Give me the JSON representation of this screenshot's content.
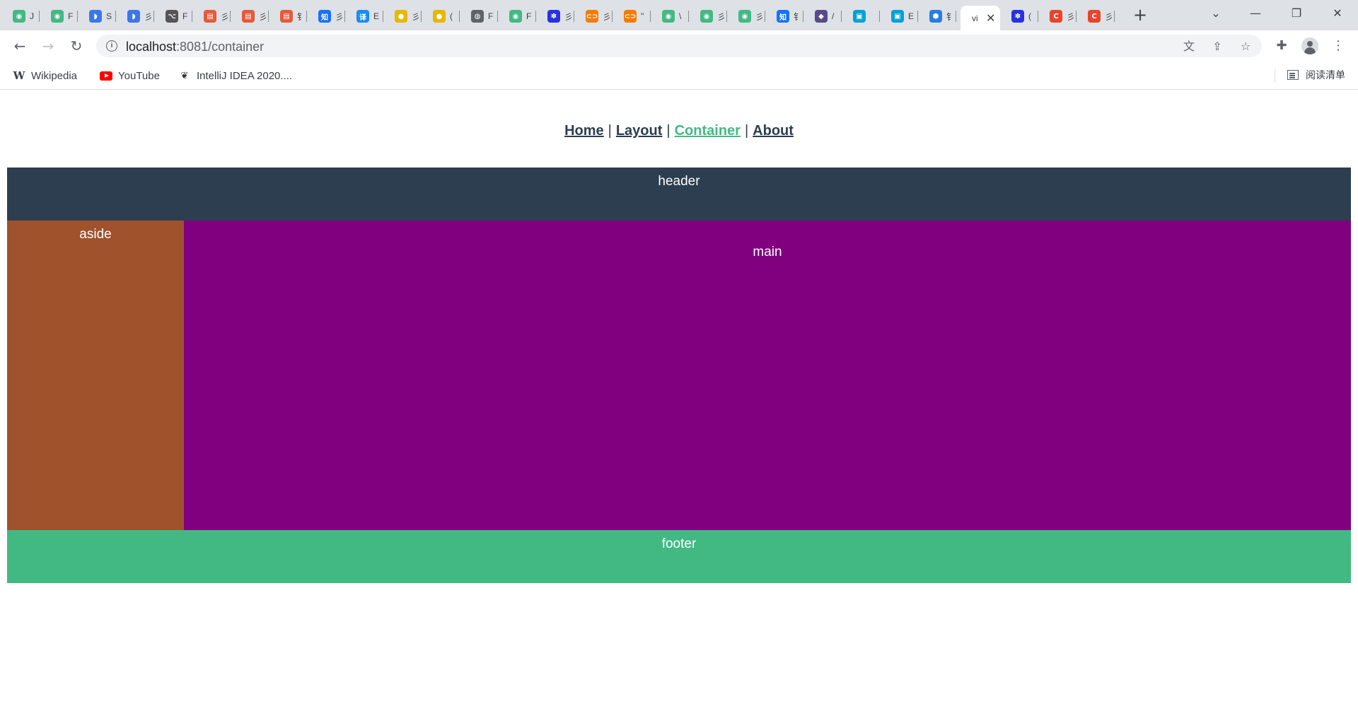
{
  "browser": {
    "tabs": [
      {
        "fav": "vue",
        "title": "J",
        "color": "#42b983"
      },
      {
        "fav": "vue",
        "title": "F",
        "color": "#42b983"
      },
      {
        "fav": "bd",
        "title": "S",
        "color": "#3c77e6"
      },
      {
        "fav": "bd",
        "title": "彡",
        "color": "#3c77e6"
      },
      {
        "fav": "git",
        "title": "F",
        "color": "#555555"
      },
      {
        "fav": "api",
        "title": "彡",
        "color": "#e45a3b"
      },
      {
        "fav": "api",
        "title": "彡",
        "color": "#e45a3b"
      },
      {
        "fav": "api",
        "title": "钅",
        "color": "#e45a3b"
      },
      {
        "fav": "知",
        "title": "彡",
        "color": "#1772f6"
      },
      {
        "fav": "译",
        "title": "E",
        "color": "#1a8cf0"
      },
      {
        "fav": "py",
        "title": "彡",
        "color": "#e6b800"
      },
      {
        "fav": "py",
        "title": "(",
        "color": "#e6b800"
      },
      {
        "fav": "globe",
        "title": "F",
        "color": "#5f6368"
      },
      {
        "fav": "vue",
        "title": "F",
        "color": "#42b983"
      },
      {
        "fav": "paw",
        "title": "彡",
        "color": "#2932e1"
      },
      {
        "fav": "link",
        "title": "彡",
        "color": "#f57c00"
      },
      {
        "fav": "link",
        "title": "\"",
        "color": "#f57c00"
      },
      {
        "fav": "vue",
        "title": "\\",
        "color": "#42b983"
      },
      {
        "fav": "vue",
        "title": "彡",
        "color": "#42b983"
      },
      {
        "fav": "vue",
        "title": "彡",
        "color": "#42b983"
      },
      {
        "fav": "知",
        "title": "钅",
        "color": "#1772f6"
      },
      {
        "fav": "gh",
        "title": "/",
        "color": "#5a4a8a"
      },
      {
        "fav": "tv",
        "title": "",
        "color": "#00a1d6"
      },
      {
        "fav": "tv",
        "title": "E",
        "color": "#00a1d6"
      },
      {
        "fav": "hex",
        "title": "钅",
        "color": "#2a7de1"
      },
      {
        "fav": "",
        "title": "vi",
        "color": "#ffffff",
        "active": true
      },
      {
        "fav": "paw",
        "title": "(",
        "color": "#2932e1"
      },
      {
        "fav": "C",
        "title": "彡",
        "color": "#e8452c"
      },
      {
        "fav": "C",
        "title": "彡",
        "color": "#e8452c"
      }
    ],
    "url_host": "localhost",
    "url_path": ":8081/container",
    "bookmarks": [
      {
        "icon": "W",
        "label": "Wikipedia"
      },
      {
        "icon": "youtube",
        "label": "YouTube"
      },
      {
        "icon": "idea",
        "label": "IntelliJ IDEA 2020...."
      }
    ],
    "reading_list_label": "阅读清单"
  },
  "nav": {
    "home": "Home",
    "layout": "Layout",
    "container": "Container",
    "about": "About",
    "separator": "|"
  },
  "layout": {
    "header": "header",
    "aside": "aside",
    "main": "main",
    "footer": "footer"
  },
  "colors": {
    "header": "#2c3e50",
    "aside": "#a0522d",
    "main": "#800080",
    "footer": "#42b983",
    "nav_active": "#42b983",
    "nav_text": "#2c3e50"
  }
}
